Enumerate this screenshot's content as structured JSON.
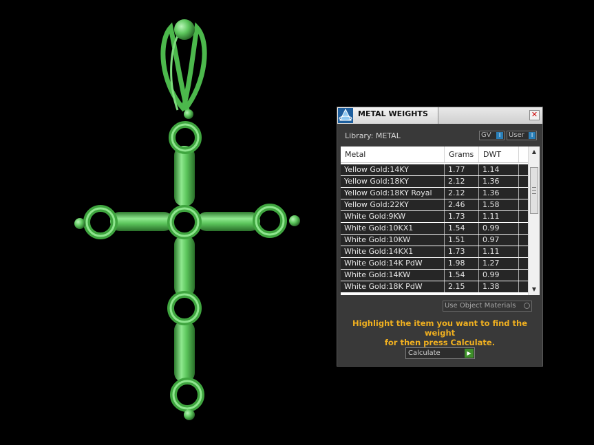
{
  "panel": {
    "title": "METAL WEIGHTS",
    "close_glyph": "✕",
    "library_label": "Library: METAL",
    "toggles": [
      {
        "label": "GV",
        "knob": "I"
      },
      {
        "label": "User",
        "knob": "I"
      }
    ],
    "columns": [
      "Metal",
      "Grams",
      "DWT"
    ],
    "rows": [
      {
        "metal": "Yellow Gold:14KY",
        "grams": "1.77",
        "dwt": "1.14"
      },
      {
        "metal": "Yellow Gold:18KY",
        "grams": "2.12",
        "dwt": "1.36"
      },
      {
        "metal": "Yellow Gold:18KY Royal",
        "grams": "2.12",
        "dwt": "1.36"
      },
      {
        "metal": "Yellow Gold:22KY",
        "grams": "2.46",
        "dwt": "1.58"
      },
      {
        "metal": "White Gold:9KW",
        "grams": "1.73",
        "dwt": "1.11"
      },
      {
        "metal": "White Gold:10KX1",
        "grams": "1.54",
        "dwt": "0.99"
      },
      {
        "metal": "White Gold:10KW",
        "grams": "1.51",
        "dwt": "0.97"
      },
      {
        "metal": "White Gold:14KX1",
        "grams": "1.73",
        "dwt": "1.11"
      },
      {
        "metal": "White Gold:14K PdW",
        "grams": "1.98",
        "dwt": "1.27"
      },
      {
        "metal": "White Gold:14KW",
        "grams": "1.54",
        "dwt": "0.99"
      },
      {
        "metal": "White Gold:18K PdW",
        "grams": "2.15",
        "dwt": "1.38"
      }
    ],
    "use_object_materials": "Use Object Materials",
    "hint_line1": "Highlight the item you want to find the weight",
    "hint_line2": "for then press Calculate.",
    "calculate_label": "Calculate",
    "calculate_glyph": "▶",
    "scroll_up": "▲",
    "scroll_down": "▼"
  },
  "colors": {
    "model_green": "#5cc65c",
    "accent_text": "#f0b020",
    "toggle_knob": "#2a7fb8",
    "go_button": "#3e8f2a"
  },
  "icons": {
    "app": "pyramid-logo-icon",
    "close": "close-icon",
    "calculate": "play-arrow-icon"
  }
}
